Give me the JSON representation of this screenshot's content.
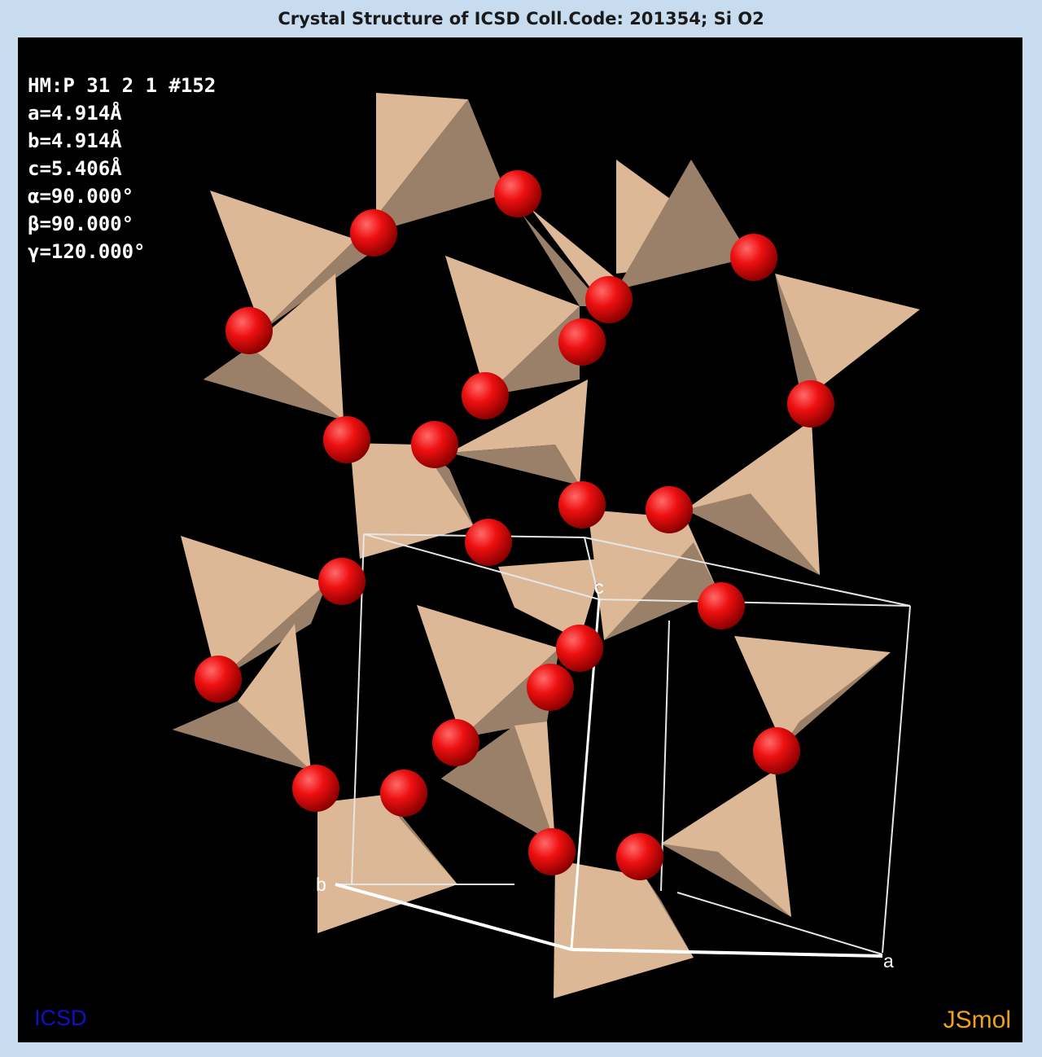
{
  "window": {
    "title": "Crystal Structure of ICSD Coll.Code: 201354; Si O2"
  },
  "cell_info": {
    "space_group": "HM:P 31 2 1 #152",
    "a": "a=4.914Å",
    "b": "b=4.914Å",
    "c": "c=5.406Å",
    "alpha": "α=90.000°",
    "beta": "β=90.000°",
    "gamma": "γ=120.000°"
  },
  "axes": {
    "a": "a",
    "b": "b",
    "c": "c"
  },
  "watermarks": {
    "left": "ICSD",
    "right": "JSmol"
  },
  "colors": {
    "background": "#000000",
    "frame": "#c8dcf0",
    "tetrahedron_light": "#ddb896",
    "tetrahedron_dark": "#9a8068",
    "oxygen": "#ee1010",
    "cell_edges": "#e6e6e6"
  }
}
